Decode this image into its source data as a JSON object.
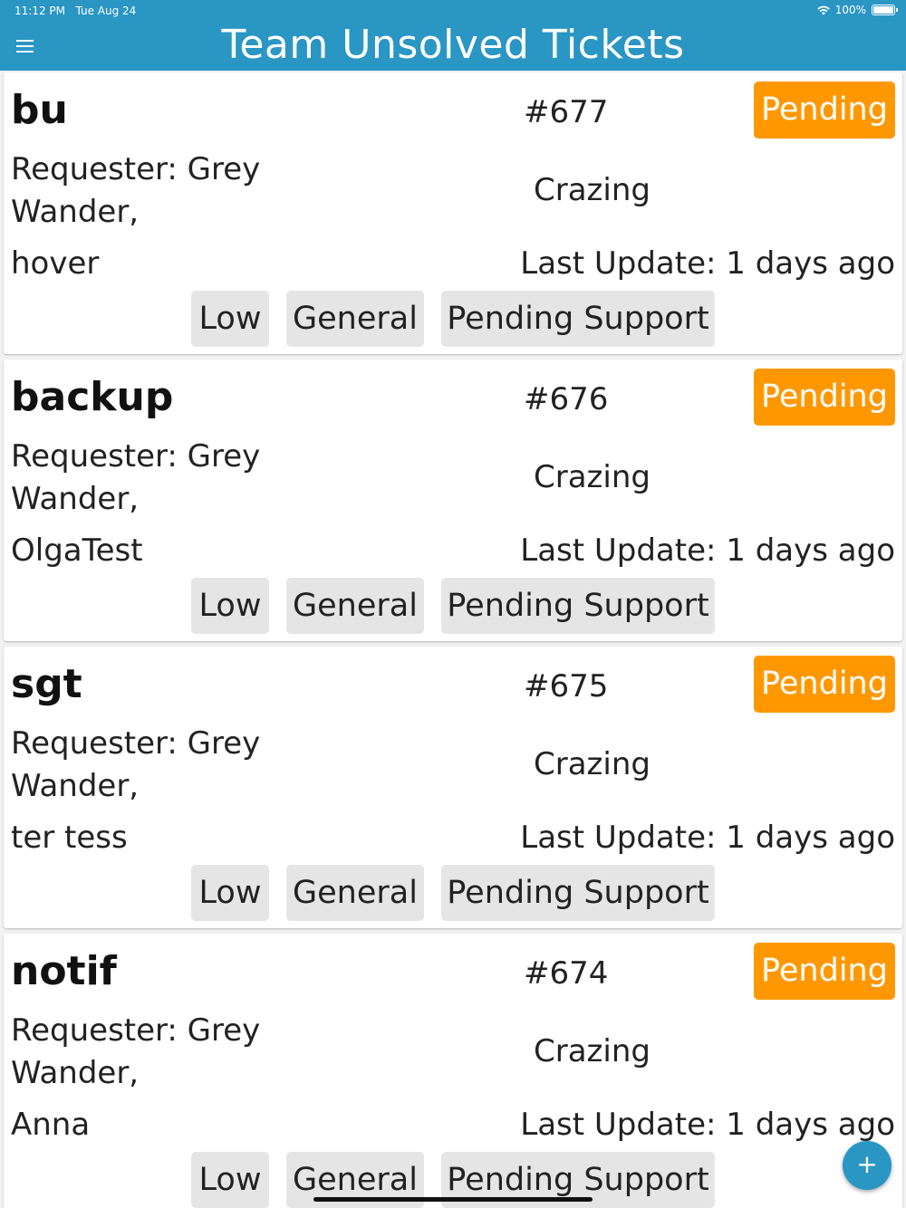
{
  "status_bar": {
    "time": "11:12 PM",
    "date": "Tue Aug 24",
    "battery": "100%"
  },
  "header": {
    "title": "Team Unsolved Tickets",
    "menu_icon": "hamburger-menu-icon"
  },
  "colors": {
    "accent": "#2a96c4",
    "status_pending": "#ff9800",
    "tag_background": "#e5e5e5"
  },
  "tickets": [
    {
      "subject": "bu",
      "id": "#677",
      "status": "Pending",
      "requester_line1": "Requester: Grey",
      "requester_line2": "Wander,",
      "group": "Crazing",
      "requester_name": "hover",
      "last_update": "Last Update: 1 days ago",
      "priority": "Low",
      "type": "General",
      "state": "Pending Support"
    },
    {
      "subject": "backup",
      "id": "#676",
      "status": "Pending",
      "requester_line1": "Requester: Grey",
      "requester_line2": "Wander,",
      "group": "Crazing",
      "requester_name": "OlgaTest",
      "last_update": "Last Update: 1 days ago",
      "priority": "Low",
      "type": "General",
      "state": "Pending Support"
    },
    {
      "subject": "sgt",
      "id": "#675",
      "status": "Pending",
      "requester_line1": "Requester: Grey",
      "requester_line2": "Wander,",
      "group": "Crazing",
      "requester_name": "ter tess",
      "last_update": "Last Update: 1 days ago",
      "priority": "Low",
      "type": "General",
      "state": "Pending Support"
    },
    {
      "subject": "notif",
      "id": "#674",
      "status": "Pending",
      "requester_line1": "Requester: Grey",
      "requester_line2": "Wander,",
      "group": "Crazing",
      "requester_name": "Anna",
      "last_update": "Last Update: 1 days ago",
      "priority": "Low",
      "type": "General",
      "state": "Pending Support"
    }
  ],
  "fab": {
    "icon": "plus-icon",
    "label": "+"
  }
}
